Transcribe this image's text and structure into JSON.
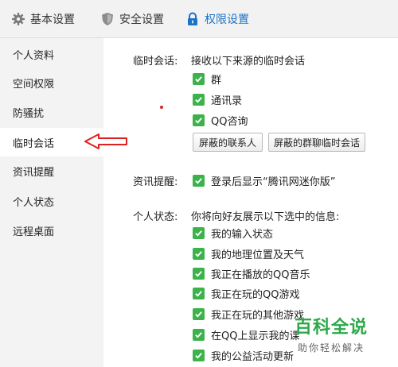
{
  "tabs": [
    {
      "label": "基本设置",
      "icon": "gear-icon"
    },
    {
      "label": "安全设置",
      "icon": "shield-icon"
    },
    {
      "label": "权限设置",
      "icon": "lock-icon",
      "active": true
    }
  ],
  "sidebar": {
    "items": [
      {
        "label": "个人资料"
      },
      {
        "label": "空间权限"
      },
      {
        "label": "防骚扰"
      },
      {
        "label": "临时会话",
        "active": true
      },
      {
        "label": "资讯提醒"
      },
      {
        "label": "个人状态"
      },
      {
        "label": "远程桌面"
      }
    ]
  },
  "temp_chat": {
    "label": "临时会话:",
    "description": "接收以下来源的临时会话",
    "options": [
      {
        "label": "群",
        "checked": true
      },
      {
        "label": "通讯录",
        "checked": true
      },
      {
        "label": "QQ咨询",
        "checked": true
      }
    ],
    "buttons": {
      "blocked_contacts": "屏蔽的联系人",
      "blocked_groups": "屏蔽的群聊临时会话"
    }
  },
  "news": {
    "label": "资讯提醒:",
    "option": {
      "label": "登录后显示“腾讯网迷你版”",
      "checked": true
    }
  },
  "status": {
    "label": "个人状态:",
    "description": "你将向好友展示以下选中的信息:",
    "options": [
      {
        "label": "我的输入状态",
        "checked": true
      },
      {
        "label": "我的地理位置及天气",
        "checked": true
      },
      {
        "label": "我正在播放的QQ音乐",
        "checked": true
      },
      {
        "label": "我正在玩的QQ游戏",
        "checked": true
      },
      {
        "label": "我正在玩的其他游戏",
        "checked": true
      },
      {
        "label": "在QQ上显示我的课",
        "checked": true
      },
      {
        "label": "我的公益活动更新",
        "checked": true
      }
    ]
  },
  "watermark": {
    "title": "百科全说",
    "subtitle": "助你轻松解决"
  },
  "colors": {
    "checkbox": "#3cb34a",
    "active_tab": "#1a73c9",
    "annotation": "#e02020",
    "watermark": "#2da84b"
  }
}
